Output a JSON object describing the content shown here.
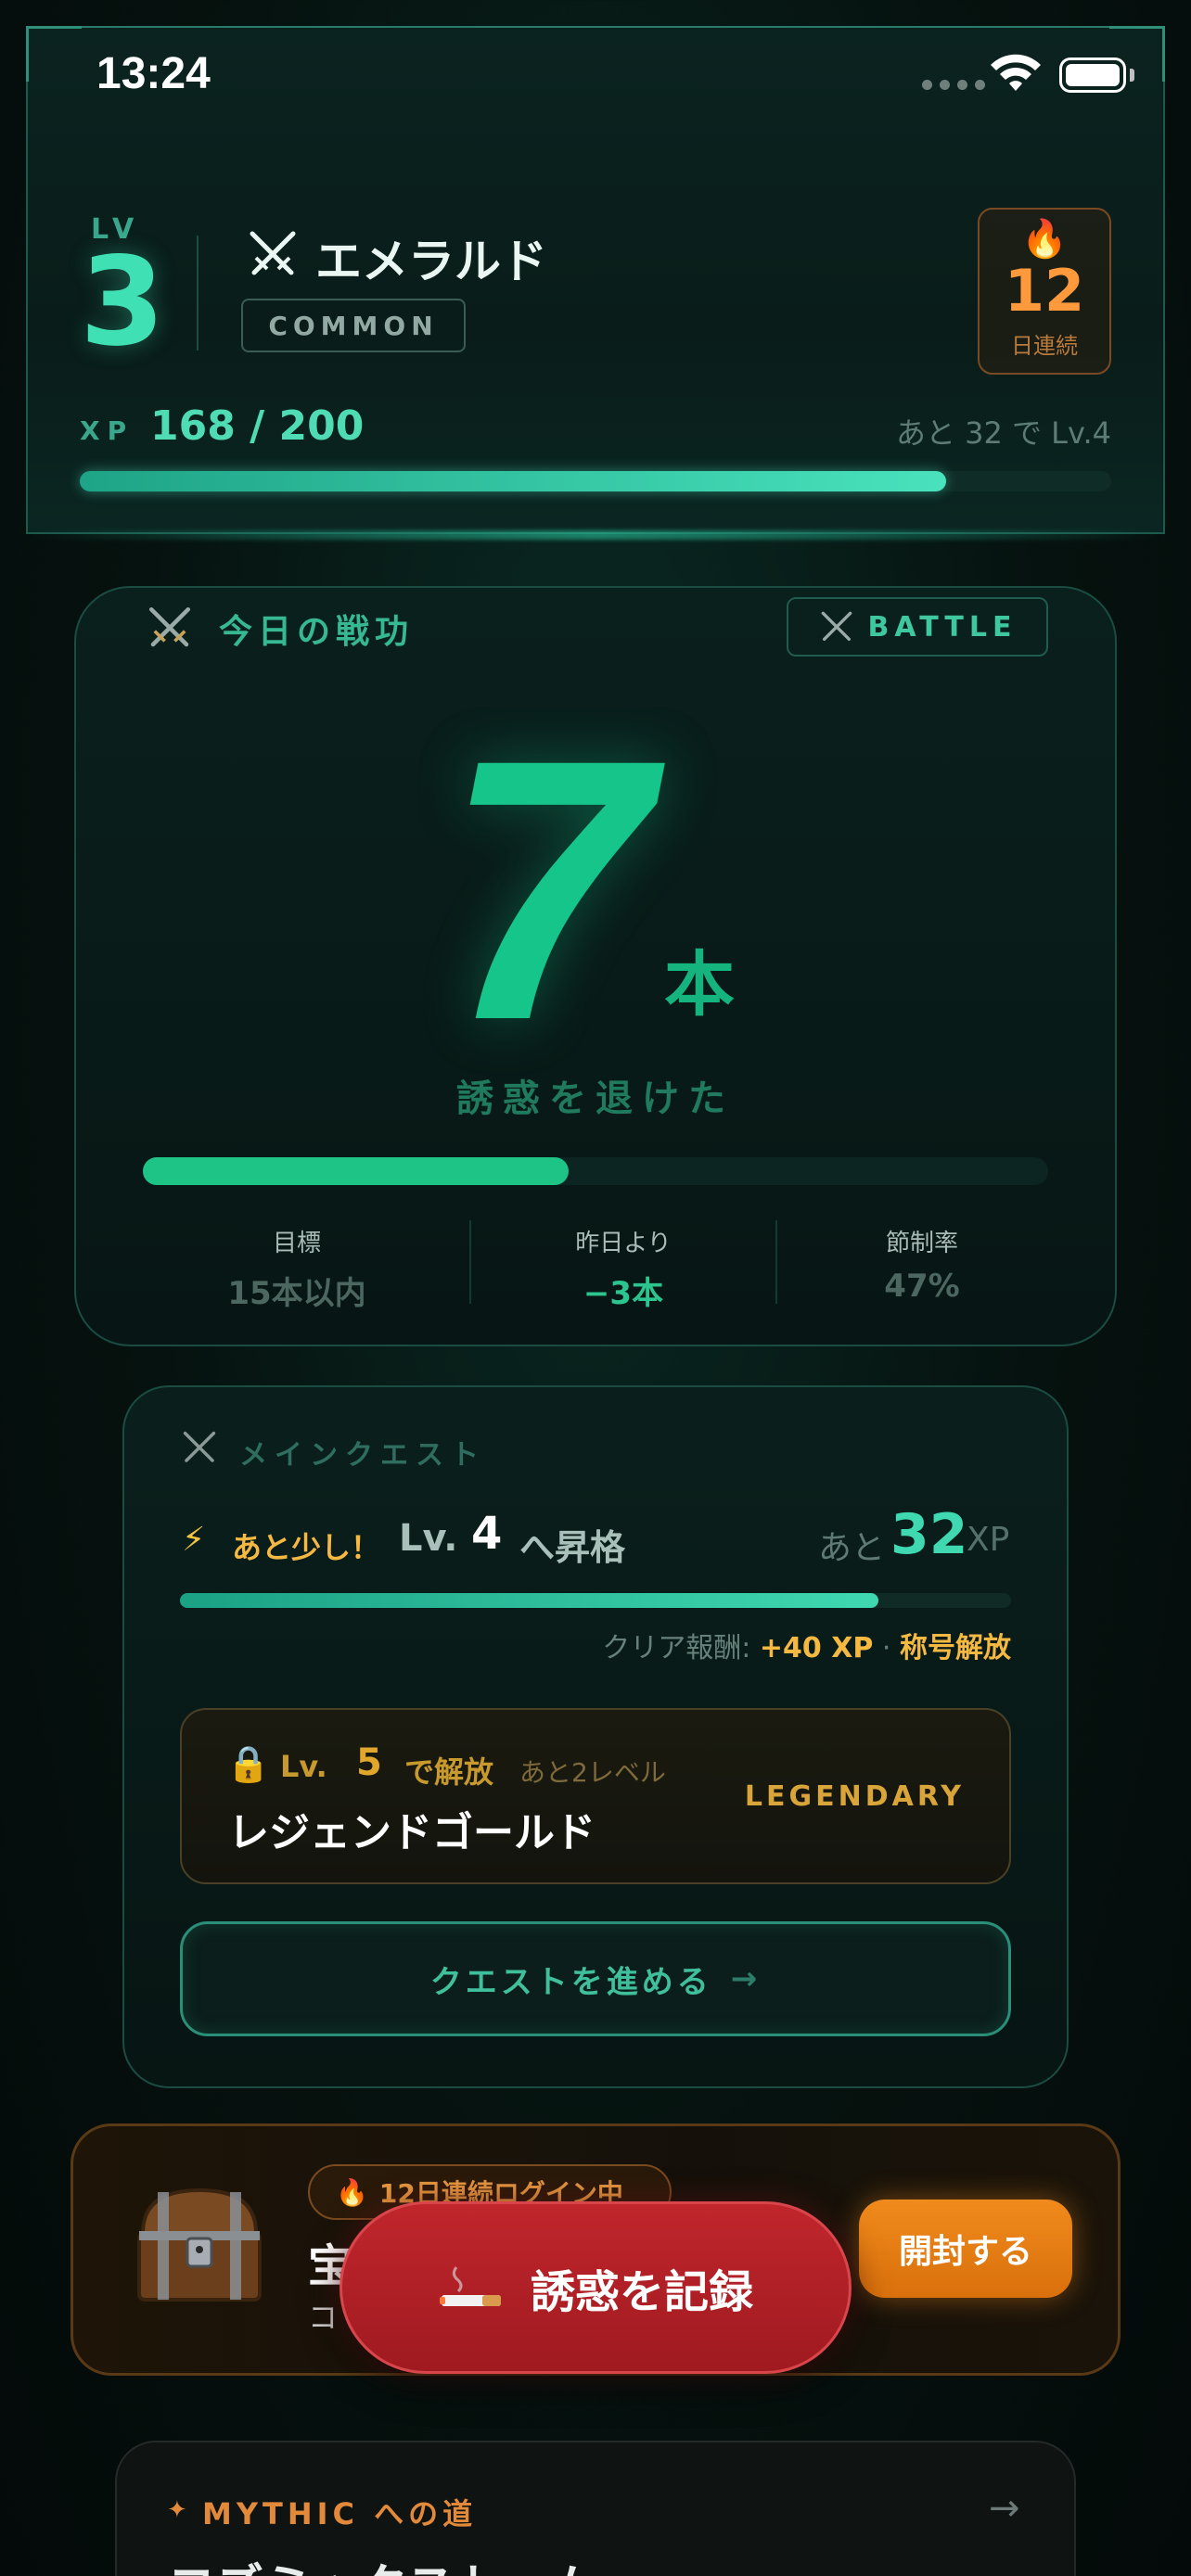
{
  "status_bar": {
    "time": "13:24"
  },
  "player": {
    "lv_label": "LV",
    "level": "3",
    "rank_name": "エメラルド",
    "rarity": "COMMON",
    "streak_days": "12",
    "streak_unit": "日連続",
    "xp_label": "XP",
    "xp_value": "168 / 200",
    "xp_progress": 0.84,
    "xp_remaining_text": "あと 32 で Lv.4"
  },
  "battle": {
    "title": "今日の戦功",
    "badge": "BATTLE",
    "count": "7",
    "unit": "本",
    "subtitle": "誘惑を退けた",
    "progress": 0.47,
    "stats": [
      {
        "label": "目標",
        "value": "15本以内"
      },
      {
        "label": "昨日より",
        "value": "−3本"
      },
      {
        "label": "節制率",
        "value": "47%"
      }
    ]
  },
  "quest": {
    "label": "メインクエスト",
    "almost": "あと少し！",
    "lv_prefix": "Lv.",
    "target_level": "4",
    "promote_text": "へ昇格",
    "remain_prefix": "あと",
    "remain_xp": "32",
    "xp_unit": "XP",
    "progress": 0.84,
    "reward_prefix": "クリア報酬:",
    "reward_xp": "+40 XP",
    "reward_sep": "·",
    "reward_title": "称号解放",
    "unlock": {
      "lv_prefix": "Lv.",
      "level": "5",
      "unlock_text": "で解放",
      "remain": "あと2レベル",
      "name": "レジェンドゴールド",
      "rarity": "LEGENDARY"
    },
    "button_label": "クエストを進める",
    "button_arrow": "→"
  },
  "treasure": {
    "login_text": "12日連続ログイン中",
    "title": "宝",
    "subtitle": "コ",
    "open_label": "開封する"
  },
  "fab": {
    "label": "誘惑を記録"
  },
  "mythic": {
    "star": "✦",
    "label": "MYTHIC への道",
    "arrow": "→",
    "title": "コズミックストーム"
  },
  "colors": {
    "accent_teal": "#3fe0b4",
    "battle_green": "#15c58a",
    "streak_orange": "#ff9a3c",
    "legend_gold": "#d9a53a",
    "fab_red": "#c0262c"
  }
}
